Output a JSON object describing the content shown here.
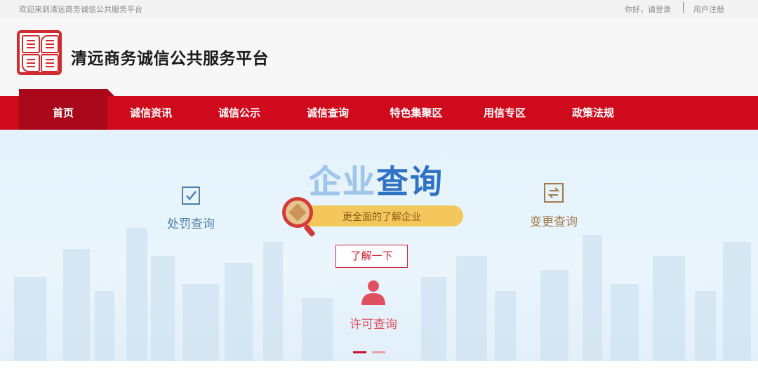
{
  "topbar": {
    "welcome": "欢迎来到清远商务诚信公共服务平台",
    "login": "你好，请登录",
    "register": "用户注册"
  },
  "header": {
    "site_title": "清远商务诚信公共服务平台",
    "logo_icon": "seal-logo-icon",
    "brand_color": "#cf0a1c"
  },
  "nav": {
    "items": [
      "首页",
      "诚信资讯",
      "诚信公示",
      "诚信查询",
      "特色集聚区",
      "用信专区",
      "政策法规"
    ],
    "active_index": 0
  },
  "hero": {
    "title_part1": "企业",
    "title_part2": "查询",
    "subtitle": "更全面的了解企业",
    "learn_more": "了解一下",
    "quick_links": {
      "penalty": {
        "label": "处罚查询",
        "icon": "checkbox-icon",
        "color": "#4f7fa6"
      },
      "change": {
        "label": "变更查询",
        "icon": "swap-document-icon",
        "color": "#a27a4c"
      },
      "license": {
        "label": "许可查询",
        "icon": "user-icon",
        "color": "#e05060"
      }
    },
    "slide_count": 2,
    "active_slide": 1
  }
}
